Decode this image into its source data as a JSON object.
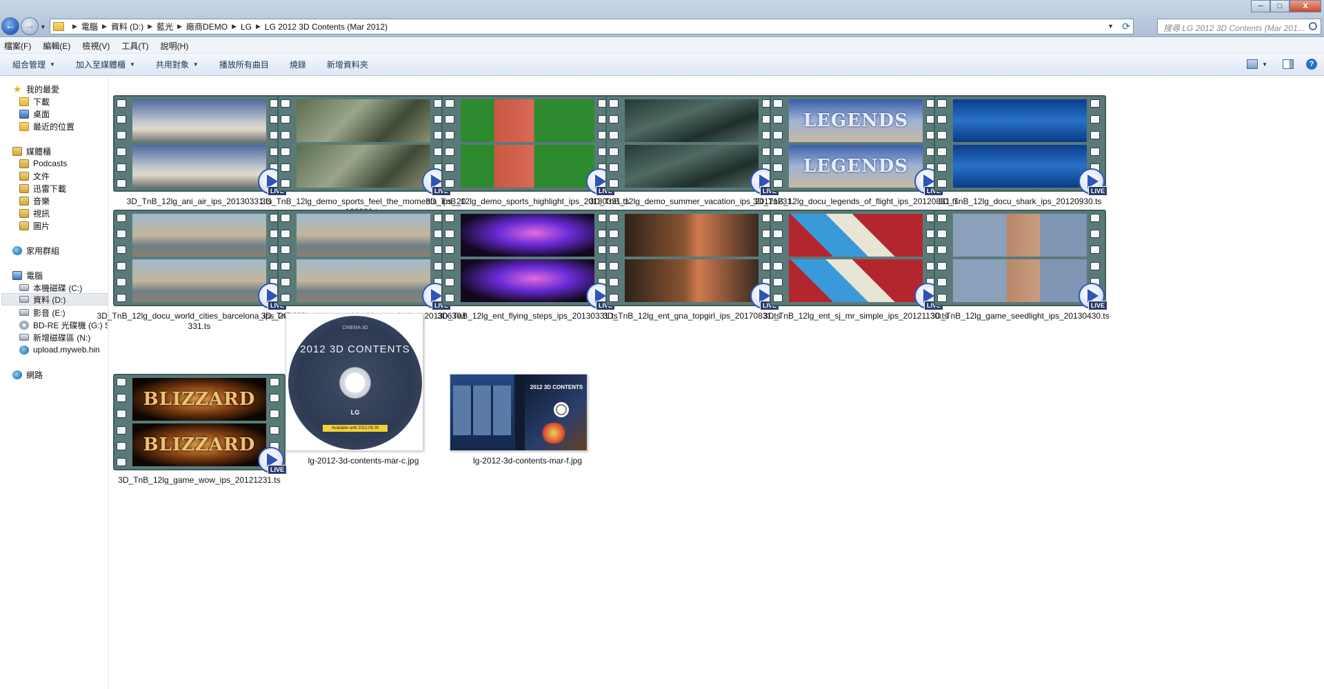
{
  "window": {
    "breadcrumbs": [
      "電腦",
      "資料 (D:)",
      "藍光",
      "廠商DEMO",
      "LG",
      "LG 2012 3D Contents (Mar 2012)"
    ],
    "search_placeholder": "搜尋 LG 2012 3D Contents (Mar 201...",
    "controls": {
      "minimize": "─",
      "maximize": "□",
      "close": "X"
    }
  },
  "menu": [
    "檔案(F)",
    "編輯(E)",
    "檢視(V)",
    "工具(T)",
    "說明(H)"
  ],
  "toolbar": {
    "organize": "組合管理",
    "add_to_library": "加入至媒體櫃",
    "share_with": "共用對象",
    "play_all": "播放所有曲目",
    "burn": "燒錄",
    "new_folder": "新增資料夾"
  },
  "sidebar": {
    "favorites": {
      "label": "我的最愛",
      "items": [
        "下載",
        "桌面",
        "最近的位置"
      ]
    },
    "libraries": {
      "label": "媒體櫃",
      "items": [
        "Podcasts",
        "文件",
        "迅雷下載",
        "音樂",
        "視訊",
        "圖片"
      ]
    },
    "homegroup": "家用群組",
    "computer": {
      "label": "電腦",
      "items": [
        "本機磁碟 (C:)",
        "資料 (D:)",
        "影音 (E:)",
        "BD-RE 光碟機 (G:) S",
        "新增磁碟區 (N:)",
        "upload.myweb.hin"
      ]
    },
    "network": "網路"
  },
  "files": [
    {
      "name": "3D_TnB_12lg_ani_air_ips_20130331.ts",
      "art": "sky",
      "badge": "LIVE"
    },
    {
      "name": "3D_TnB_12lg_demo_sports_feel_the_moments_ips_20130331.ts",
      "art": "jungle",
      "badge": "LIVE"
    },
    {
      "name": "3D_TnB_12lg_demo_sports_highlight_ips_20130331.ts",
      "art": "track",
      "badge": "LIVE"
    },
    {
      "name": "3D_TnB_12lg_demo_summer_vacation_ips_20121231.ts",
      "art": "forest",
      "badge": "LIVE"
    },
    {
      "name": "3D_TnB_12lg_docu_legends_of_flight_ips_20120831.ts",
      "art": "legends",
      "frame_text": "LEGENDS",
      "badge": "LIVE"
    },
    {
      "name": "3D_TnB_12lg_docu_shark_ips_20120930.ts",
      "art": "ocean",
      "badge": "LIVE"
    },
    {
      "name": "3D_TnB_12lg_docu_world_cities_barcelona_ips_20130331.ts",
      "art": "city",
      "badge": "LIVE"
    },
    {
      "name": "3D_TnB_12lg_docu_world_cities_paris_ips_20130630.ts",
      "art": "city",
      "badge": "LIVE"
    },
    {
      "name": "3D_TnB_12lg_ent_flying_steps_ips_20130331.ts",
      "art": "nebula",
      "badge": "LIVE"
    },
    {
      "name": "3D_TnB_12lg_ent_gna_topgirl_ips_20170831.ts",
      "art": "girl",
      "badge": "LIVE"
    },
    {
      "name": "3D_TnB_12lg_ent_sj_mr_simple_ips_20121130.ts",
      "art": "cartoon",
      "badge": "LIVE"
    },
    {
      "name": "3D_TnB_12lg_game_seedlight_ips_20130430.ts",
      "art": "tower",
      "badge": "LIVE"
    },
    {
      "name": "3D_TnB_12lg_game_wow_ips_20121231.ts",
      "art": "blizzard",
      "frame_text": "BLIZZARD",
      "badge": "LIVE"
    },
    {
      "name": "lg-2012-3d-contents-mar-c.jpg",
      "art": "disc",
      "disc_title": "2012 3D CONTENTS",
      "disc_brand": "CINEMA 3D",
      "disc_logo": "LG",
      "disc_available": "Available until 2012.09.30"
    },
    {
      "name": "lg-2012-3d-contents-mar-f.jpg",
      "art": "cover",
      "cover_title": "2012 3D CONTENTS"
    }
  ]
}
